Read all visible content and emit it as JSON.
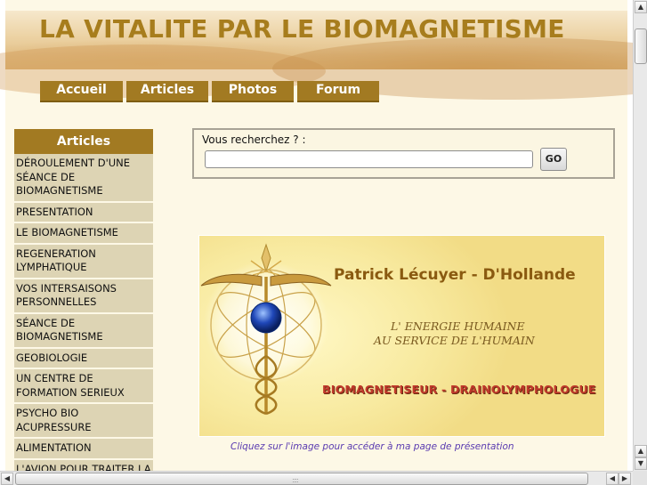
{
  "header": {
    "title": "LA VITALITE PAR LE BIOMAGNETISME"
  },
  "nav": {
    "items": [
      {
        "label": "Accueil"
      },
      {
        "label": "Articles"
      },
      {
        "label": "Photos"
      },
      {
        "label": "Forum"
      }
    ]
  },
  "sidebar": {
    "heading": "Articles",
    "items": [
      {
        "label": "DÉROULEMENT D'UNE SÉANCE DE BIOMAGNETISME"
      },
      {
        "label": "PRESENTATION"
      },
      {
        "label": "LE BIOMAGNETISME"
      },
      {
        "label": "REGENERATION LYMPHATIQUE"
      },
      {
        "label": "VOS INTERSAISONS PERSONNELLES"
      },
      {
        "label": "SÉANCE DE BIOMAGNETISME"
      },
      {
        "label": "GEOBIOLOGIE"
      },
      {
        "label": "UN CENTRE DE FORMATION SERIEUX"
      },
      {
        "label": "PSYCHO BIO ACUPRESSURE"
      },
      {
        "label": "ALIMENTATION"
      },
      {
        "label": "L'AVION POUR TRAITER LA COQUELUCHE"
      }
    ]
  },
  "search": {
    "label": "Vous recherchez ? :",
    "value": "",
    "button_label": "GO"
  },
  "promo": {
    "name": "Patrick Lécuyer - D'Hollande",
    "line1": "L' ENERGIE HUMAINE",
    "line2": "AU SERVICE DE L'HUMAIN",
    "role": "BIOMAGNETISEUR - DRAINOLYMPHOLOGUE",
    "emblem_text": "BIOMAGNETISEUR - DRAINOLYMPHOLOGUE",
    "caption": "Cliquez sur l'image pour accéder à ma page de présentation"
  },
  "scrollbars": {
    "up_icon": "arrow-up",
    "down_icon": "arrow-down",
    "left_icon": "arrow-left",
    "right_icon": "arrow-right"
  },
  "colors": {
    "accent": "#a27a22",
    "page_bg": "#fdf8e6",
    "sidebar_item_bg": "#ddd4b4",
    "title": "#a77d1d",
    "caption": "#5a3bb0",
    "role_text": "#c0392b"
  }
}
